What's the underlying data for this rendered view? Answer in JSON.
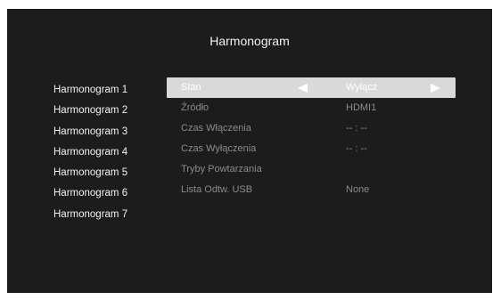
{
  "title": "Harmonogram",
  "schedules": [
    "Harmonogram 1",
    "Harmonogram 2",
    "Harmonogram 3",
    "Harmonogram 4",
    "Harmonogram 5",
    "Harmonogram 6",
    "Harmonogram 7"
  ],
  "settings": [
    {
      "label": "Stan",
      "value": "Wyłącz"
    },
    {
      "label": "Źródło",
      "value": "HDMI1"
    },
    {
      "label": "Czas Włączenia",
      "value": "-- : --"
    },
    {
      "label": "Czas Wyłączenia",
      "value": "-- : --"
    },
    {
      "label": "Tryby Powtarzania",
      "value": ""
    },
    {
      "label": "Lista Odtw. USB",
      "value": "None"
    }
  ],
  "colors": {
    "background": "#1c1c1c",
    "highlight": "#d9d9d9",
    "text": "#f2f2f2",
    "dim_text": "#8a8a8a"
  }
}
